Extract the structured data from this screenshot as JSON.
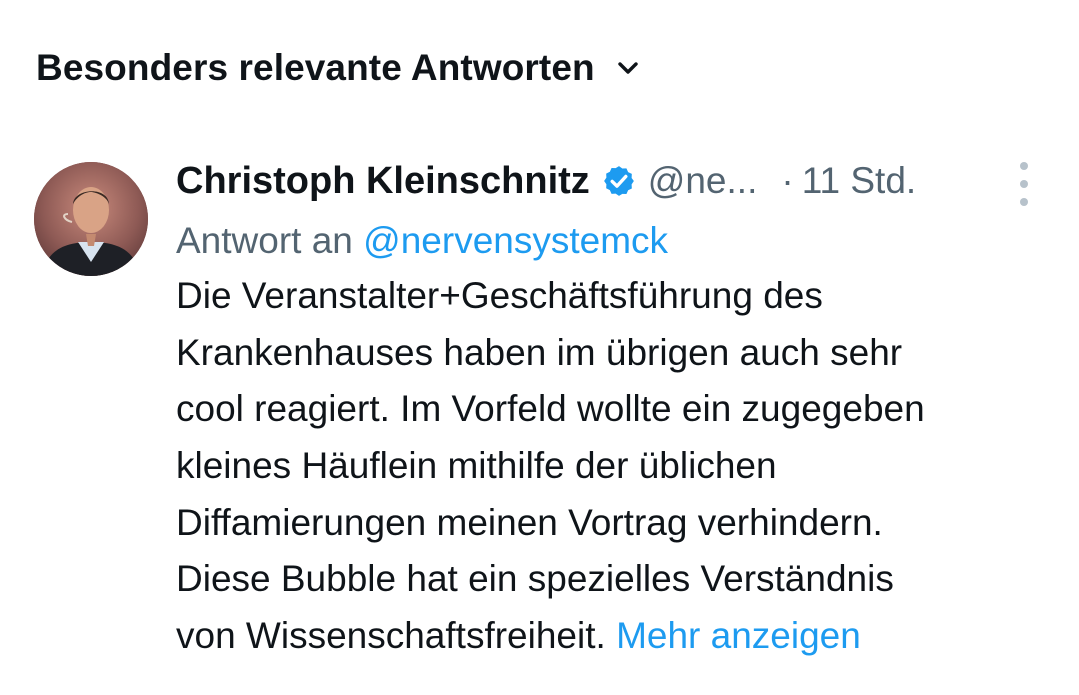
{
  "sort": {
    "label": "Besonders relevante Antworten",
    "icon": "chevron-down-icon"
  },
  "reply": {
    "author": {
      "display_name": "Christoph Kleinschnitz",
      "verified": true,
      "handle": "@ne...",
      "avatar": "avatar"
    },
    "separator": "·",
    "time": "11 Std.",
    "reply_prefix": "Antwort an",
    "reply_to": "@nervensystemck",
    "text_lines": [
      "Die Veranstalter+Geschäftsführung des",
      "Krankenhauses haben im übrigen auch sehr",
      "cool reagiert. Im Vorfeld wollte ein zugegeben",
      "kleines Häuflein mithilfe der üblichen",
      "Diffamierungen meinen Vortrag verhindern.",
      "Diese Bubble hat ein spezielles Verständnis",
      "von Wissenschaftsfreiheit."
    ],
    "show_more": "Mehr anzeigen"
  },
  "colors": {
    "text_primary": "#0f1419",
    "text_secondary": "#536471",
    "accent": "#1d9bf0",
    "more_dots": "#b7c2cb"
  }
}
